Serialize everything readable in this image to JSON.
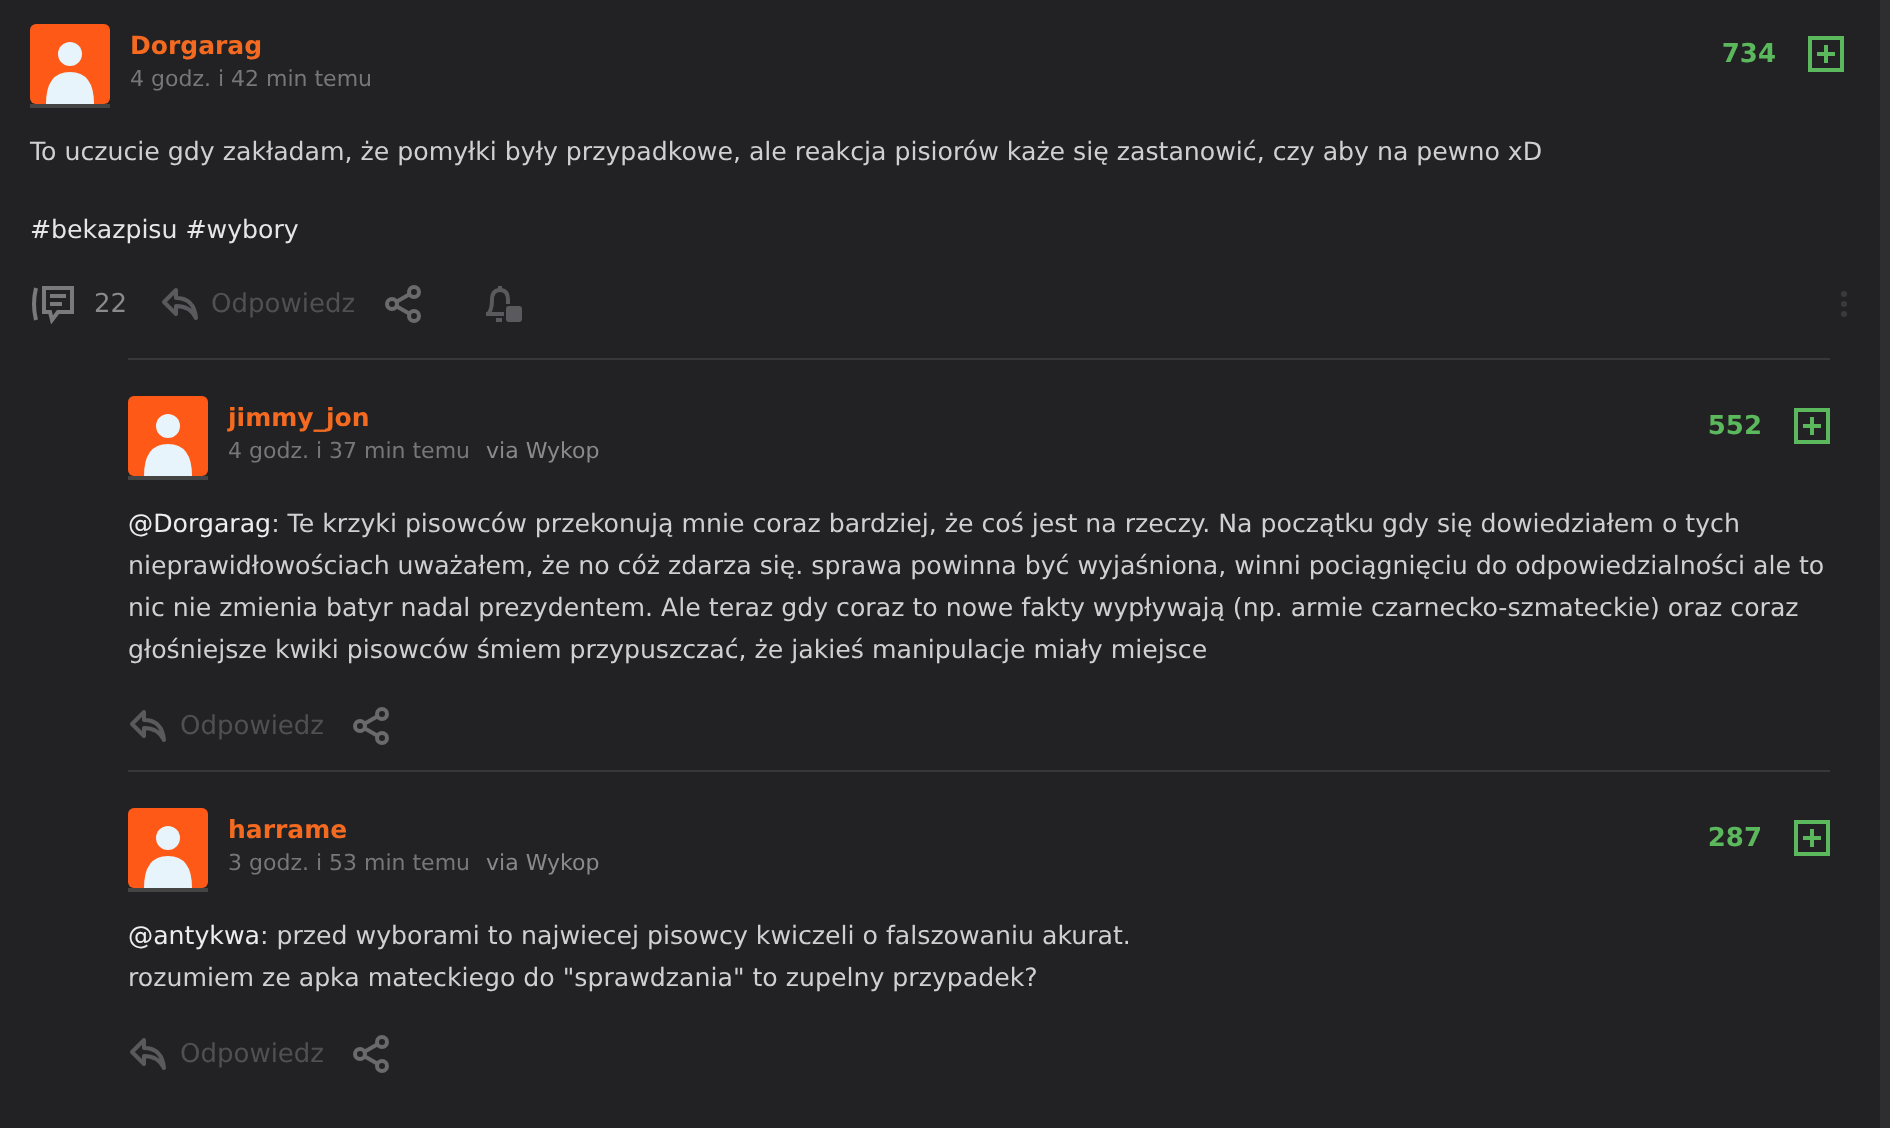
{
  "post": {
    "author": "Dorgarag",
    "time": "4 godz. i 42 min temu",
    "score": "734",
    "text": "To uczucie gdy zakładam, że pomyłki były przypadkowe, ale reakcja pisiorów każe się zastanowić, czy aby na pewno xD",
    "tags": "#bekazpisu #wybory",
    "comments": "22",
    "reply": "Odpowiedz"
  },
  "replies": [
    {
      "author": "jimmy_jon",
      "time": "4 godz. i 37 min temu",
      "via": "via Wykop",
      "score": "552",
      "mention": "@Dorgarag",
      "text": ": Te krzyki pisowców przekonują mnie coraz bardziej, że coś jest na rzeczy. Na początku gdy się dowiedziałem o tych nieprawidłowościach uważałem, że no cóż zdarza się. sprawa powinna być wyjaśniona, winni pociągnięciu do odpowiedzialności ale to nic nie zmienia batyr nadal prezydentem. Ale teraz gdy coraz to nowe fakty wypływają (np. armie czarnecko-szmateckie) oraz coraz głośniejsze kwiki pisowców śmiem przypuszczać, że jakieś manipulacje miały miejsce",
      "reply": "Odpowiedz"
    },
    {
      "author": "harrame",
      "time": "3 godz. i 53 min temu",
      "via": "via Wykop",
      "score": "287",
      "mention": "@antykwa",
      "text": ": przed wyborami to najwiecej pisowcy kwiczeli o falszowaniu akurat.\nrozumiem ze apka mateckiego do \"sprawdzania\" to zupelny przypadek?",
      "reply": "Odpowiedz"
    }
  ]
}
